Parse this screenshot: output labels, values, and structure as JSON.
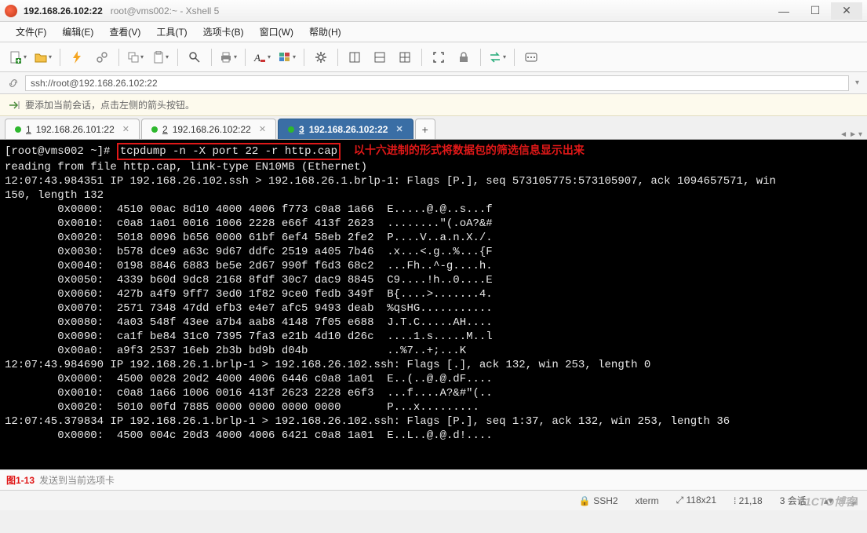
{
  "window": {
    "title_ip": "192.168.26.102:22",
    "title_sub": "root@vms002:~ - Xshell 5"
  },
  "menu": [
    "文件(F)",
    "编辑(E)",
    "查看(V)",
    "工具(T)",
    "选项卡(B)",
    "窗口(W)",
    "帮助(H)"
  ],
  "address": "ssh://root@192.168.26.102:22",
  "infobar": "要添加当前会话，点击左侧的箭头按钮。",
  "tabs": [
    {
      "num": "1",
      "label": "192.168.26.101:22",
      "active": false
    },
    {
      "num": "2",
      "label": "192.168.26.102:22",
      "active": false
    },
    {
      "num": "3",
      "label": "192.168.26.102:22",
      "active": true
    }
  ],
  "terminal": {
    "prompt": "[root@vms002 ~]# ",
    "command": "tcpdump -n -X port 22 -r http.cap",
    "annotation": "以十六进制的形式将数据包的筛选信息显示出来",
    "lines": [
      "reading from file http.cap, link-type EN10MB (Ethernet)",
      "12:07:43.984351 IP 192.168.26.102.ssh > 192.168.26.1.brlp-1: Flags [P.], seq 573105775:573105907, ack 1094657571, win",
      "150, length 132",
      "        0x0000:  4510 00ac 8d10 4000 4006 f773 c0a8 1a66  E.....@.@..s...f",
      "        0x0010:  c0a8 1a01 0016 1006 2228 e66f 413f 2623  ........\"(.oA?&#",
      "        0x0020:  5018 0096 b656 0000 61bf 6ef4 58eb 2fe2  P....V..a.n.X./.",
      "        0x0030:  b578 dce9 a63c 9d67 ddfc 2519 a405 7b46  .x...<.g..%...{F",
      "        0x0040:  0198 8846 6883 be5e 2d67 990f f6d3 68c2  ...Fh..^-g....h.",
      "        0x0050:  4339 b60d 9dc8 2168 8fdf 30c7 dac9 8845  C9....!h..0....E",
      "        0x0060:  427b a4f9 9ff7 3ed0 1f82 9ce0 fedb 349f  B{....>.......4.",
      "        0x0070:  2571 7348 47dd efb3 e4e7 afc5 9493 deab  %qsHG...........",
      "        0x0080:  4a03 548f 43ee a7b4 aab8 4148 7f05 e688  J.T.C.....AH....",
      "        0x0090:  ca1f be84 31c0 7395 7fa3 e21b 4d10 d26c  ....1.s.....M..l",
      "        0x00a0:  a9f3 2537 16eb 2b3b bd9b d04b            ..%7..+;...K",
      "12:07:43.984690 IP 192.168.26.1.brlp-1 > 192.168.26.102.ssh: Flags [.], ack 132, win 253, length 0",
      "        0x0000:  4500 0028 20d2 4000 4006 6446 c0a8 1a01  E..(..@.@.dF....",
      "        0x0010:  c0a8 1a66 1006 0016 413f 2623 2228 e6f3  ...f....A?&#\"(..",
      "        0x0020:  5010 00fd 7885 0000 0000 0000 0000       P...x.........",
      "12:07:45.379834 IP 192.168.26.1.brlp-1 > 192.168.26.102.ssh: Flags [P.], seq 1:37, ack 132, win 253, length 36",
      "        0x0000:  4500 004c 20d3 4000 4006 6421 c0a8 1a01  E..L..@.@.d!...."
    ]
  },
  "figure_label": "图1-13",
  "hint": "发送到当前选项卡",
  "status": {
    "proto": "SSH2",
    "term": "xterm",
    "size": "118x21",
    "pos": "21,18",
    "sess": "3 会话"
  },
  "watermark": "51CTO博客"
}
